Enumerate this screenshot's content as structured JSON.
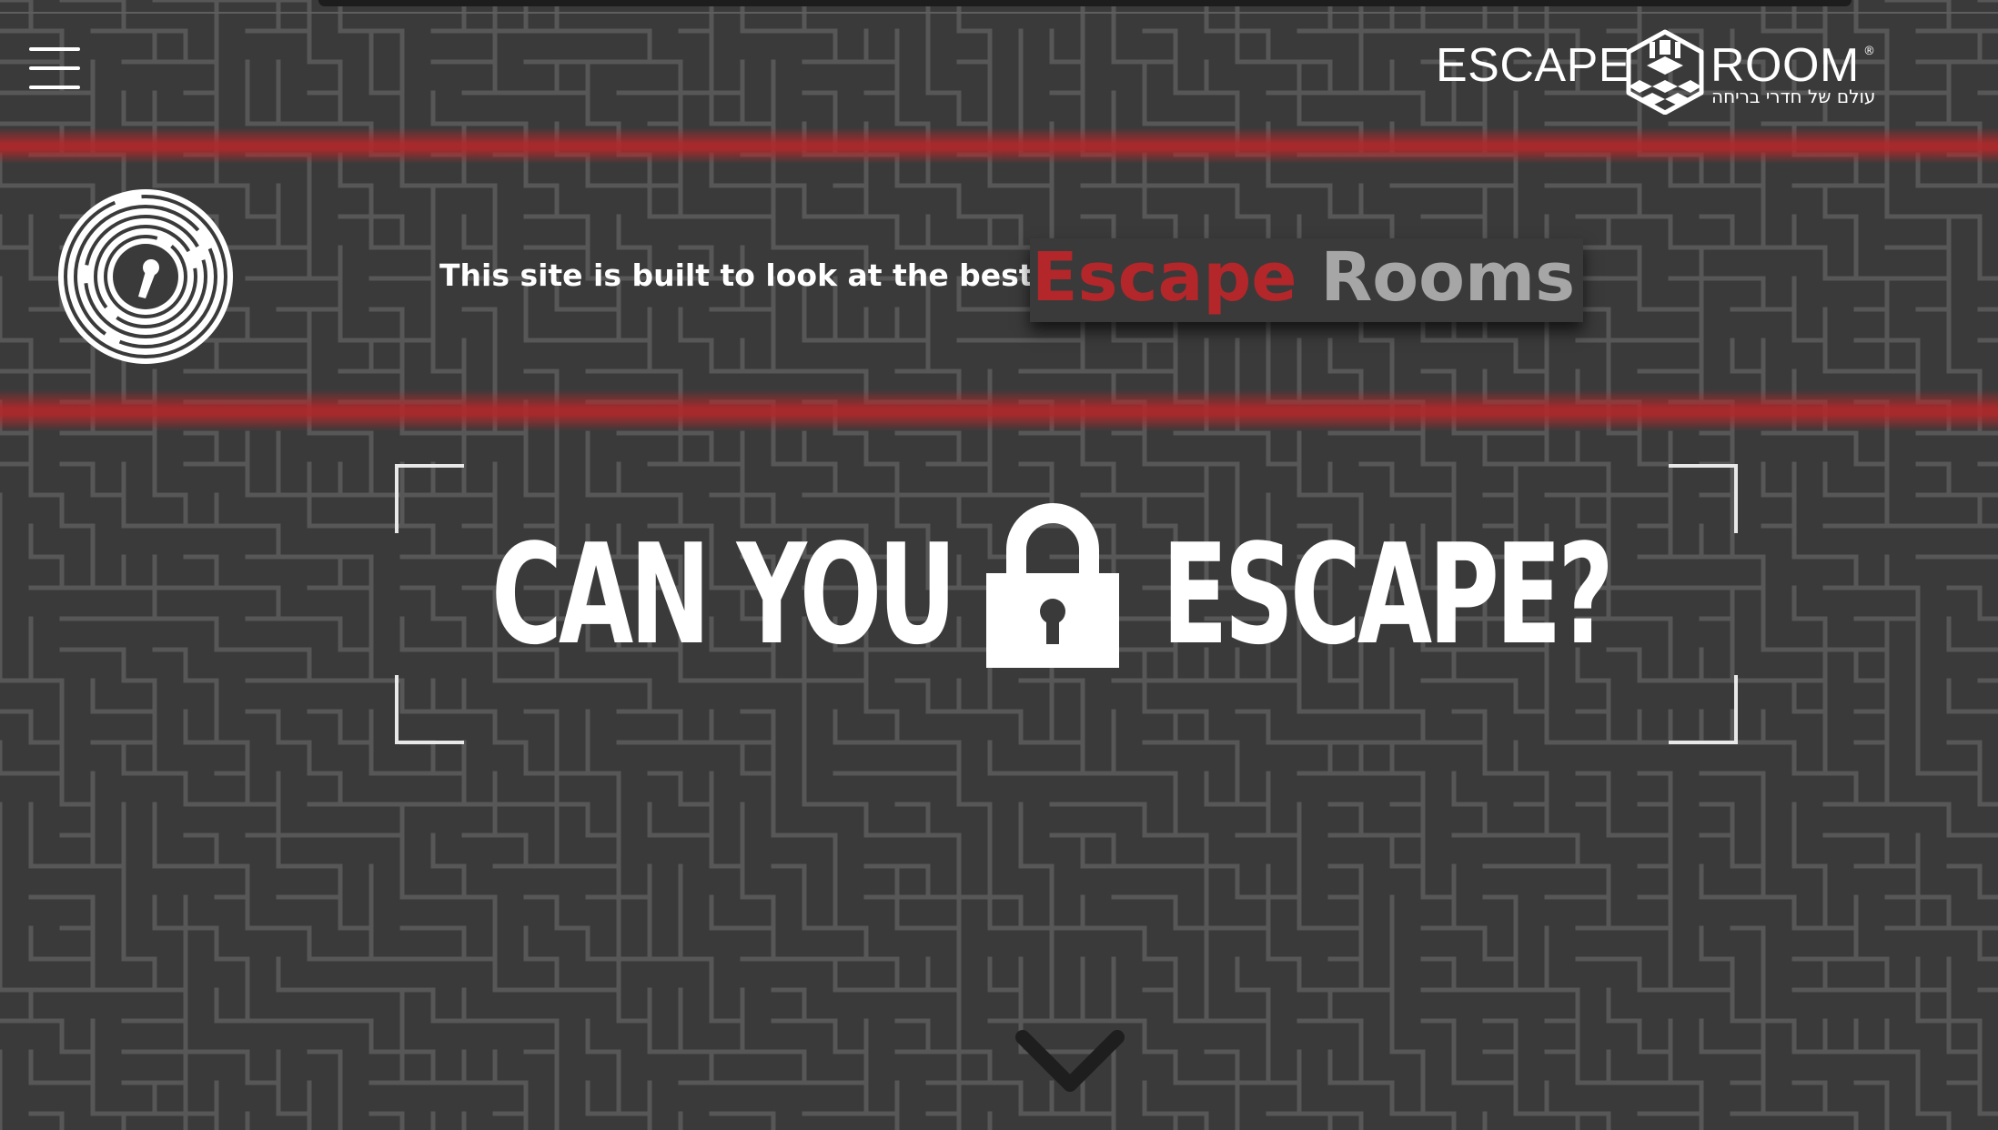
{
  "header": {
    "menu_icon": "hamburger-menu-icon",
    "logo": {
      "word_left": "ESCAPE",
      "word_right": "ROOM",
      "registered": "®",
      "tagline_hebrew": "עולם של חדרי בריחה",
      "cube_icon": "escape-room-cube-icon"
    }
  },
  "hero": {
    "emblem_icon": "circular-maze-keyhole-icon",
    "tagline": "This site is built to look at the best :",
    "highlight_word1": "Escape",
    "highlight_word2": "Rooms",
    "headline_left": "CAN YOU",
    "headline_right": "ESCAPE?",
    "lock_icon": "padlock-icon",
    "scroll_icon": "chevron-down-icon"
  },
  "colors": {
    "background": "#3a3a3a",
    "maze_lines": "#575757",
    "accent_red": "#b3262a",
    "highlight_gray": "#a6a6a6",
    "text_white": "#ffffff"
  }
}
